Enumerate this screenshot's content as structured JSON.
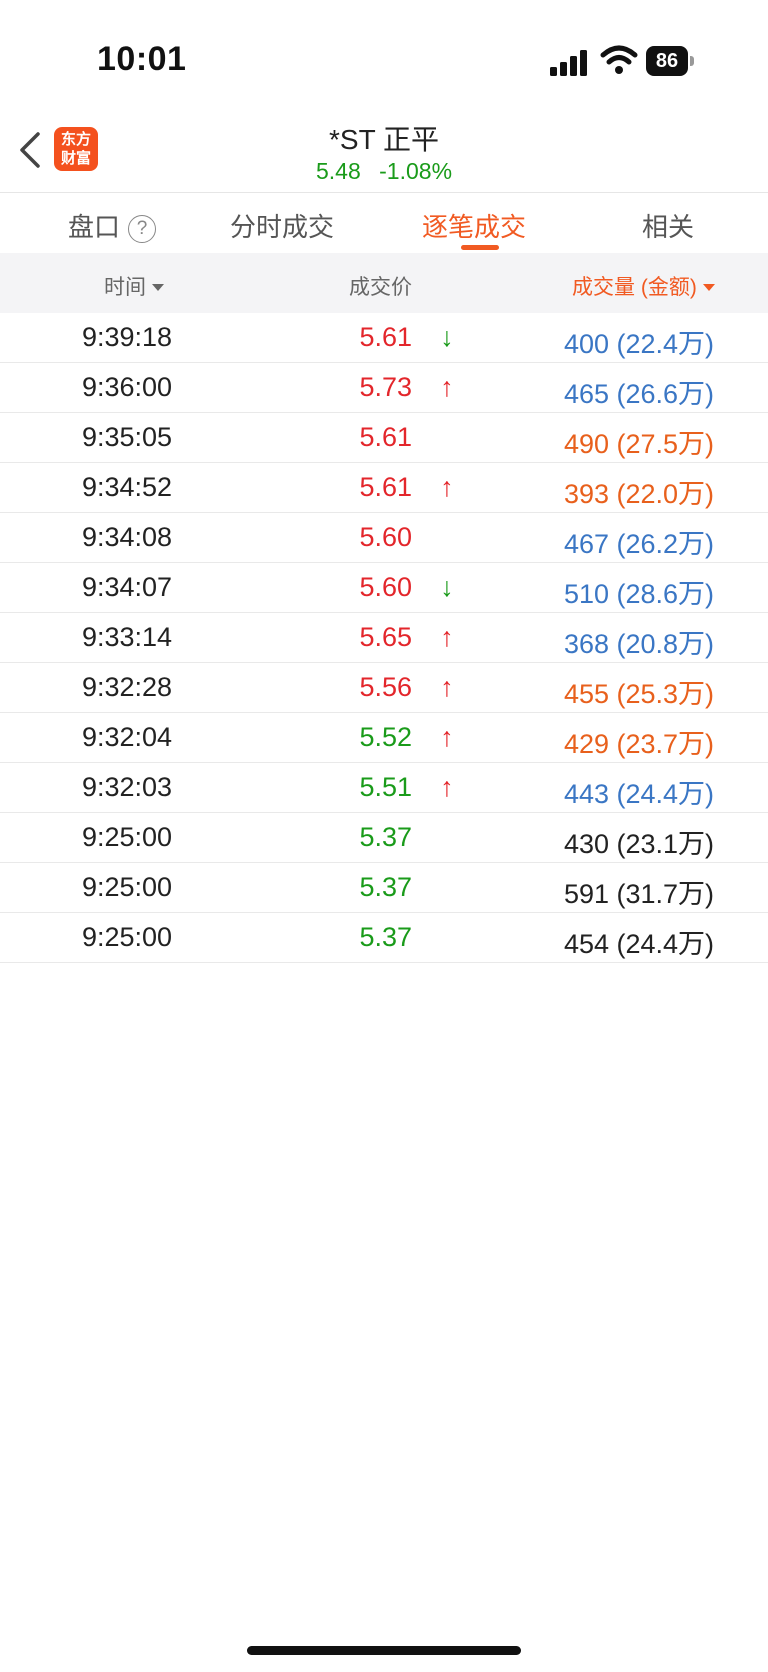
{
  "status_bar": {
    "time": "10:01",
    "battery": "86",
    "icons": [
      "signal-icon",
      "wifi-icon",
      "battery-icon"
    ]
  },
  "header": {
    "logo_line1": "东方",
    "logo_line2": "财富",
    "stock_name": "*ST 正平",
    "price": "5.48",
    "change_pct": "-1.08%",
    "quote_color": "#1a9b1a"
  },
  "tabs": [
    {
      "label": "盘口",
      "has_help": true,
      "help": "?"
    },
    {
      "label": "分时成交"
    },
    {
      "label": "逐笔成交",
      "active": true
    },
    {
      "label": "相关"
    }
  ],
  "columns": {
    "time": "时间",
    "price": "成交价",
    "volume": "成交量 (金额)"
  },
  "colors": {
    "accent": "#f15a22",
    "up": "#e3262b",
    "down": "#1a9b1a",
    "buy": "#3a76c4",
    "sell": "#e8601c"
  },
  "trades": [
    {
      "time": "9:39:18",
      "price": "5.61",
      "price_color": "red",
      "arrow": "↓",
      "arrow_color": "green",
      "volume": "400 (22.4万)",
      "vol_color": "blue"
    },
    {
      "time": "9:36:00",
      "price": "5.73",
      "price_color": "red",
      "arrow": "↑",
      "arrow_color": "red",
      "volume": "465 (26.6万)",
      "vol_color": "blue"
    },
    {
      "time": "9:35:05",
      "price": "5.61",
      "price_color": "red",
      "arrow": "",
      "arrow_color": "",
      "volume": "490 (27.5万)",
      "vol_color": "orange"
    },
    {
      "time": "9:34:52",
      "price": "5.61",
      "price_color": "red",
      "arrow": "↑",
      "arrow_color": "red",
      "volume": "393 (22.0万)",
      "vol_color": "orange"
    },
    {
      "time": "9:34:08",
      "price": "5.60",
      "price_color": "red",
      "arrow": "",
      "arrow_color": "",
      "volume": "467 (26.2万)",
      "vol_color": "blue"
    },
    {
      "time": "9:34:07",
      "price": "5.60",
      "price_color": "red",
      "arrow": "↓",
      "arrow_color": "green",
      "volume": "510 (28.6万)",
      "vol_color": "blue"
    },
    {
      "time": "9:33:14",
      "price": "5.65",
      "price_color": "red",
      "arrow": "↑",
      "arrow_color": "red",
      "volume": "368 (20.8万)",
      "vol_color": "blue"
    },
    {
      "time": "9:32:28",
      "price": "5.56",
      "price_color": "red",
      "arrow": "↑",
      "arrow_color": "red",
      "volume": "455 (25.3万)",
      "vol_color": "orange"
    },
    {
      "time": "9:32:04",
      "price": "5.52",
      "price_color": "green",
      "arrow": "↑",
      "arrow_color": "red",
      "volume": "429 (23.7万)",
      "vol_color": "orange"
    },
    {
      "time": "9:32:03",
      "price": "5.51",
      "price_color": "green",
      "arrow": "↑",
      "arrow_color": "red",
      "volume": "443 (24.4万)",
      "vol_color": "blue"
    },
    {
      "time": "9:25:00",
      "price": "5.37",
      "price_color": "green",
      "arrow": "",
      "arrow_color": "",
      "volume": "430 (23.1万)",
      "vol_color": "dark"
    },
    {
      "time": "9:25:00",
      "price": "5.37",
      "price_color": "green",
      "arrow": "",
      "arrow_color": "",
      "volume": "591 (31.7万)",
      "vol_color": "dark"
    },
    {
      "time": "9:25:00",
      "price": "5.37",
      "price_color": "green",
      "arrow": "",
      "arrow_color": "",
      "volume": "454 (24.4万)",
      "vol_color": "dark"
    }
  ]
}
